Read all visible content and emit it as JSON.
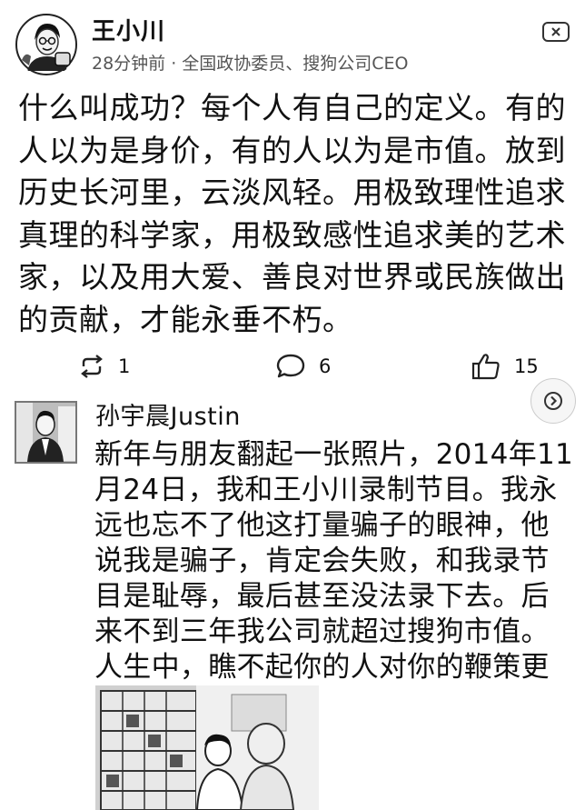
{
  "post1": {
    "author": "王小川",
    "time": "28分钟前",
    "separator": "·",
    "source": "全国政协委员、搜狗公司CEO",
    "body": "什么叫成功？每个人有自己的定义。有的人以为是身价，有的人以为是市值。放到历史长河里，云淡风轻。用极致理性追求真理的科学家，用极致感性追求美的艺术家，以及用大爱、善良对世界或民族做出的贡献，才能永垂不朽。",
    "actions": {
      "repost_count": "1",
      "comment_count": "6",
      "like_count": "15"
    },
    "icons": {
      "close": "close-icon",
      "repost": "repost-icon",
      "comment": "comment-icon",
      "like": "thumbs-up-icon"
    }
  },
  "post2": {
    "author": "孙宇晨Justin",
    "body": "新年与朋友翻起一张照片，2014年11月24日，我和王小川录制节目。我永远也忘不了他这打量骗子的眼神，他说我是骗子，肯定会失败，和我录节目是耻辱，最后甚至没法录下去。后来不到三年我公司就超过搜狗市值。人生中，瞧不起你的人对你的鞭策更加刻骨铭心。",
    "icons": {
      "more": "chevron-right-icon"
    }
  }
}
